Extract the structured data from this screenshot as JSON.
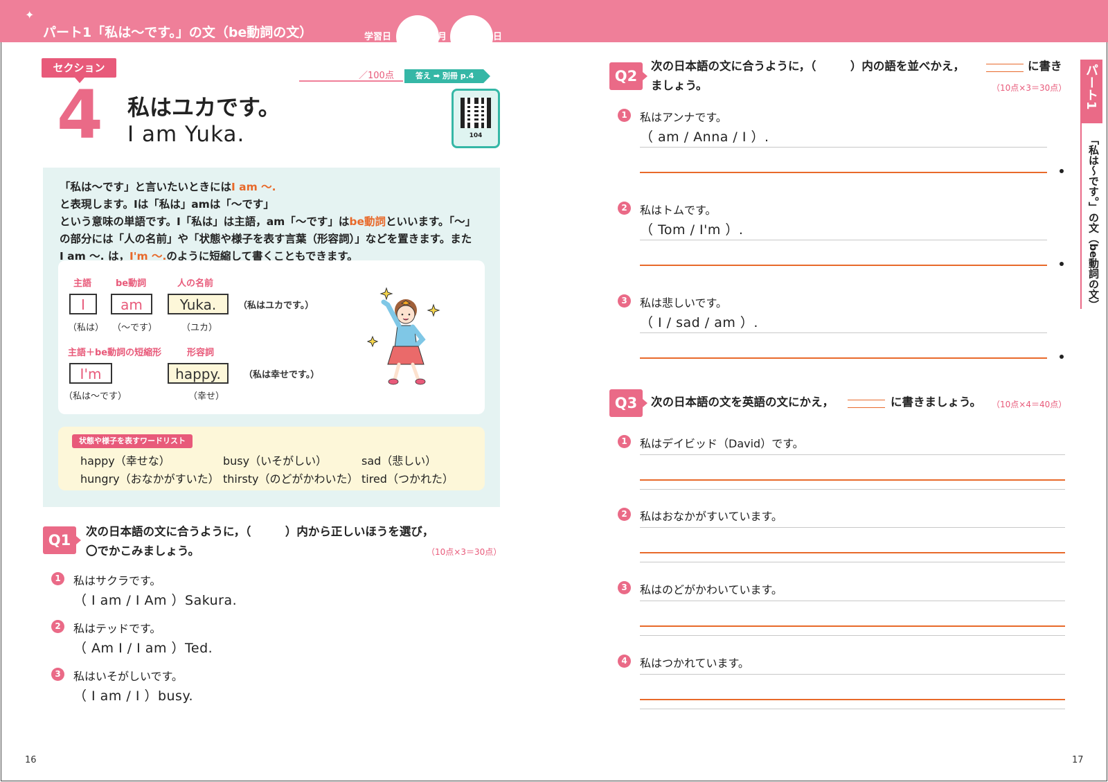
{
  "header": {
    "title": "パート1「私は〜です。」の文（be動詞の文）",
    "date_label": "学習日",
    "month_label": "月",
    "day_label": "日"
  },
  "section": {
    "badge": "セクション",
    "number": "4",
    "title_jp": "私はユカです。",
    "title_en": "I am Yuka.",
    "score": "／100点",
    "answer_ref": "答え ➡ 別冊 p.4",
    "qr_code": "104"
  },
  "explanation": {
    "line1_a": "「私は〜です」と言いたいときには",
    "line1_hl": "I am 〜.",
    "line1_b": "と表現します。Iは「私は」amは「〜です」",
    "line2_a": "という意味の単語です。I「私は」は主語，am「〜です」は",
    "line2_hl": "be動詞",
    "line2_b": "といいます。「〜」",
    "line3": "の部分には「人の名前」や「状態や様子を表す言葉（形容詞）」などを置きます。また",
    "line4_a": "I am 〜. は，",
    "line4_hl": "I'm 〜.",
    "line4_b": "のように短縮して書くこともできます。"
  },
  "diagram": {
    "label_subject": "主語",
    "label_be": "be動詞",
    "label_name": "人の名前",
    "box_i": "I",
    "box_am": "am",
    "box_yuka": "Yuka.",
    "sentence1_jp": "（私はユカです。）",
    "sub_i": "（私は）",
    "sub_am": "（〜です）",
    "sub_yuka": "（ユカ）",
    "label_contraction": "主語＋be動詞の短縮形",
    "label_adjective": "形容詞",
    "box_im": "I'm",
    "box_happy": "happy.",
    "sentence2_jp": "（私は幸せです。）",
    "sub_im": "（私は〜です）",
    "sub_happy": "（幸せ）"
  },
  "wordlist": {
    "tag": "状態や様子を表すワードリスト",
    "items": [
      "happy（幸せな）",
      "busy（いそがしい）",
      "sad（悲しい）",
      "hungry（おなかがすいた）",
      "thirsty（のどがかわいた）",
      "tired（つかれた）"
    ]
  },
  "q1": {
    "badge": "Q1",
    "instruction_line1": "次の日本語の文に合うように，（　　　）内から正しいほうを選び，",
    "instruction_line2": "〇でかこみましょう。",
    "score": "（10点×3＝30点）",
    "items": [
      {
        "num": "1",
        "jp": "私はサクラです。",
        "en": "（ I am / I Am ）Sakura."
      },
      {
        "num": "2",
        "jp": "私はテッドです。",
        "en": "（ Am I / I am ）Ted."
      },
      {
        "num": "3",
        "jp": "私はいそがしいです。",
        "en": "（ I am / I ）busy."
      }
    ]
  },
  "q2": {
    "badge": "Q2",
    "instruction_line1_a": "次の日本語の文に合うように，（　　　）内の語を並べかえ，",
    "instruction_line1_b": "に書き",
    "instruction_line2": "ましょう。",
    "score": "（10点×3＝30点）",
    "items": [
      {
        "num": "1",
        "jp": "私はアンナです。",
        "en": "（ am / Anna / I ）."
      },
      {
        "num": "2",
        "jp": "私はトムです。",
        "en": "（ Tom / I'm ）."
      },
      {
        "num": "3",
        "jp": "私は悲しいです。",
        "en": "（ I / sad / am ）."
      }
    ]
  },
  "q3": {
    "badge": "Q3",
    "instruction_a": "次の日本語の文を英語の文にかえ，",
    "instruction_b": "に書きましょう。",
    "score": "（10点×4＝40点）",
    "items": [
      {
        "num": "1",
        "jp": "私はデイビッド（David）です。"
      },
      {
        "num": "2",
        "jp": "私はおなかがすいています。"
      },
      {
        "num": "3",
        "jp": "私はのどがかわいています。"
      },
      {
        "num": "4",
        "jp": "私はつかれています。"
      }
    ]
  },
  "side": {
    "tab": "パート1",
    "text": "「私は〜です。」の文（be動詞の文）"
  },
  "pages": {
    "left": "16",
    "right": "17"
  }
}
